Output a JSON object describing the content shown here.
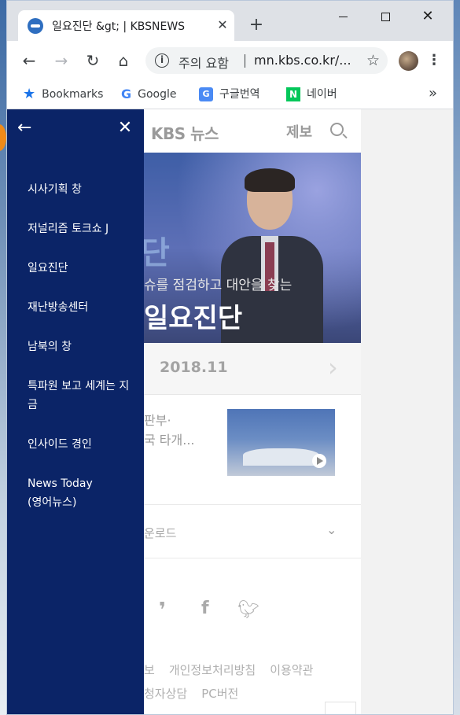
{
  "browser": {
    "tab_title": "일요진단 &gt; | KBSNEWS",
    "tab_close": "✕",
    "new_tab": "+",
    "security_label": "주의 요함",
    "url": "mn.kbs.co.kr/...",
    "bookmarks": [
      {
        "label": "Bookmarks",
        "icon": "bookmark-star-icon"
      },
      {
        "label": "Google",
        "icon": "google-icon"
      },
      {
        "label": "구글번역",
        "icon": "translate-icon"
      },
      {
        "label": "네이버",
        "icon": "naver-icon"
      }
    ],
    "bookmarks_more": "»"
  },
  "site": {
    "logo": "KBS 뉴스",
    "report": "제보",
    "hero_subtitle": "슈를 점검하고 대안을 찾는",
    "hero_title": "일요진단",
    "hero_mark": "단",
    "date": "2018.11",
    "article_line1": "판부·",
    "article_line2": "국 타개...",
    "download": "운로드",
    "footer_row1": [
      "보",
      "개인정보처리방침",
      "이용약관"
    ],
    "footer_row2": [
      "청자상담",
      "PC버전"
    ]
  },
  "drawer": {
    "items": [
      "시사기획 창",
      "저널리즘 토크쇼 J",
      "일요진단",
      "재난방송센터",
      "남북의 창",
      "특파원 보고 세계는 지금",
      "인사이드 경인",
      "News Today (영어뉴스)"
    ]
  },
  "colors": {
    "drawer_bg": "#0b2467",
    "chrome_titlebar": "#dee1e6",
    "link_blue": "#1a73e8"
  }
}
